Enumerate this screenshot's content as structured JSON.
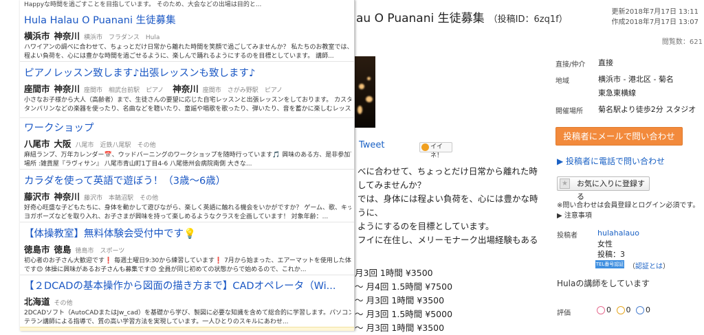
{
  "detail": {
    "title": "au O Puanani 生徒募集",
    "post_id": "（投稿ID：6zq1f）",
    "updated": "更新2018年7月17日 13:11",
    "created": "作成2018年7月17日 13:07",
    "views": "閲覧数：621",
    "tweet": "Tweet",
    "iine": "イイネ！",
    "body_lines": [
      "べに合わせて、ちょっとだけ日常から離れた時",
      "してみませんか？",
      "では、身体には程よい負荷を、心には豊かな時",
      "うに、",
      "ようにするのを目標としています。",
      "フイに在住し、メリーモナーク出場経験もある"
    ],
    "price_lines": [
      "月3回 1時間  ¥3500",
      "〜  月4回 1.5時間  ¥7500",
      "〜  月3回 1時間  ¥3500",
      "〜  月3回   1.5時間  ¥5000",
      "〜  月3回   1時間  ¥3500"
    ],
    "info": {
      "direct_label": "直接/仲介",
      "direct_value": "直接",
      "area_label": "地域",
      "area_value": "横浜市 - 港北区 - 菊名",
      "area_line": "東急東横線",
      "place_label": "開催場所",
      "place_value": "菊名駅より徒歩2分 スタジオ"
    },
    "mail_button": "投稿者にメールで問い合わせ",
    "phone_link": "▶ 投稿者に電話で問い合わせ",
    "fav_button": "お気に入りに登録する",
    "note1": "※問い合わせは会員登録とログイン必須です。",
    "note2": "▶ 注意事項",
    "poster_label": "投稿者",
    "poster_name": "hulahalauo",
    "poster_gender": "女性",
    "poster_posts": "投稿：3",
    "badge": "TEL番号認証",
    "verify_open": "（",
    "verify_link": "認証とは",
    "verify_close": "）",
    "intro": "Hulaの講師をしています",
    "rating_label": "評価",
    "rating_values": [
      "0",
      "0",
      "0"
    ]
  },
  "results": {
    "top_snippet": "Happyな時間を過ごすことを目指しています。 そのため、大会などの出場は目的と...",
    "items": [
      {
        "title": "Hula Halau O Puanani 生徒募集",
        "city": "横浜市",
        "pref": "神奈川",
        "subs": [
          "横浜市",
          "フラダンス",
          "Hula"
        ],
        "desc1": "ハワイアンの調べに合わせて、ちょっとだけ日常から離れた時間を笑顔で過ごしてみませんか？ 私たちのお教室では、身体に",
        "desc2": "程よい負荷を、心には豊かな時間を過ごせるように、楽しんで踊れるようにするのを目標としています。 講師..."
      },
      {
        "title": "ピアノレッスン致します♪出張レッスンも致します♪",
        "city": "座間市",
        "pref": "神奈川",
        "subs": [
          "座間市",
          "相武台前駅",
          "ピアノ"
        ],
        "city2": "",
        "pref2": "神奈川",
        "subs2": [
          "座間市",
          "さがみ野駅",
          "ピアノ"
        ],
        "desc1": "小さなお子様から大人（高齢者）まで、生徒さんの要望に応じた自宅レッスンと出張レッスンをしております。 カスタネット",
        "desc2": "タンバリンなどの楽器を使ったり、名曲などを聴いたり、童謡や唱歌を歌ったり、弾いたり、音を蓄かに楽しむレッス..."
      },
      {
        "title": "ワークショップ",
        "city": "八尾市",
        "pref": "大阪",
        "subs": [
          "八尾市",
          "近鉄八尾駅",
          "その他"
        ],
        "desc1": "麻紐ランプ、万年カレンダー📅、ウッドバーニングのワークショップを随時行っています🎵 興味のある方、是非参加下さい🙏",
        "desc2": "場所 :雑貨屋『ラヴィサン』 八尾市青山町1丁目4-6 八尾徳州会病院南側 大きな..."
      },
      {
        "title": "カラダを使って英語で遊ぼう！（3歳〜6歳）",
        "city": "藤沢市",
        "pref": "神奈川",
        "subs": [
          "藤沢市",
          "本鵠沼駅",
          "その他"
        ],
        "desc1": "好奇心旺盛な子どもたちに、身体を動かして遊びながら、楽しく英語に触れる機会をいかがですか？ ゲーム、歌、キッズ向け",
        "desc2": "ヨガポーズなどを取り入れ、お子さまが興味を持って楽しめるようなクラスを企画しています！ 対象年齢：..."
      },
      {
        "title": "【体操教室】無料体験会受付中です💡",
        "city": "徳島市",
        "pref": "徳島",
        "subs": [
          "徳島市",
          "スポーツ"
        ],
        "desc1": "初心者のお子さん大歓迎です❗ 毎週土曜日9:30から練習しています❗ 7月から始まった、エアーマットを使用した体操教室",
        "desc2": "です😊 体操に興味があるお子さんも募集です😊 全員が同じ初めての状態からで始めるので、これか..."
      },
      {
        "title": "【２DCADの基本操作から図面の描き方まで】CADオペレータ（Wi...",
        "city": "",
        "pref": "北海道",
        "subs": [
          "その他"
        ],
        "desc1": "2DCADソフト（AutoCADまたはJw_cad）を基礎から学び、製図に必要な知識を含めて総合的に学習します。パソコンスク",
        "desc2": "テラン講師による指導で、質の高い学習方法を実現しています。一人ひとりのスキルにあわせ..."
      }
    ]
  }
}
